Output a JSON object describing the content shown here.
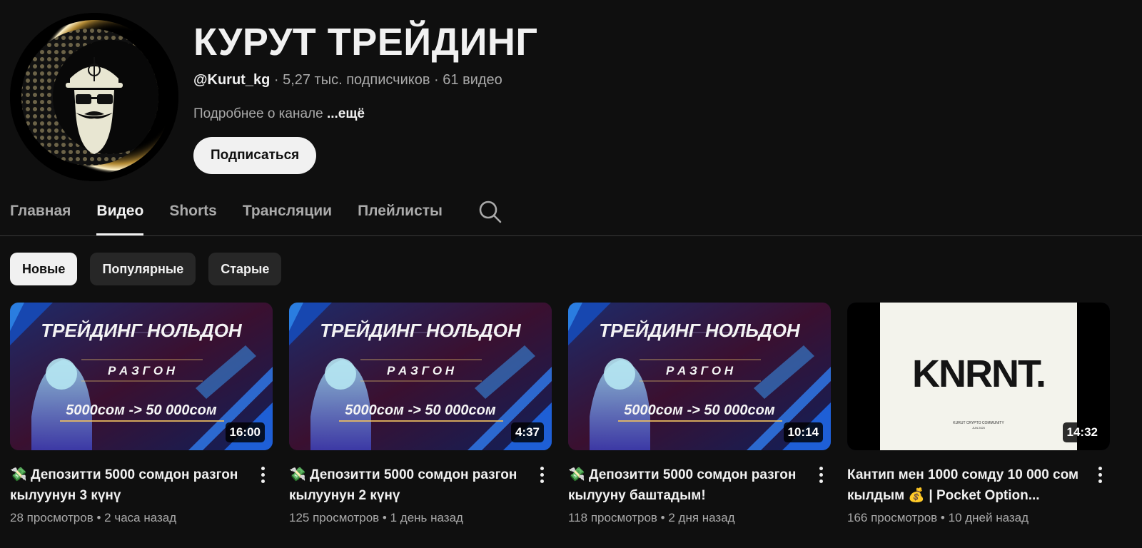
{
  "channel": {
    "title": "КУРУТ ТРЕЙДИНГ",
    "handle": "@Kurut_kg",
    "subscribers": "5,27 тыс. подписчиков",
    "video_count": "61 видео",
    "separator": " · ",
    "about": "Подробнее о канале",
    "more": "...ещё",
    "subscribe_label": "Подписаться"
  },
  "tabs": [
    {
      "label": "Главная",
      "active": false
    },
    {
      "label": "Видео",
      "active": true
    },
    {
      "label": "Shorts",
      "active": false
    },
    {
      "label": "Трансляции",
      "active": false
    },
    {
      "label": "Плейлисты",
      "active": false
    }
  ],
  "chips": [
    {
      "label": "Новые",
      "active": true
    },
    {
      "label": "Популярные",
      "active": false
    },
    {
      "label": "Старые",
      "active": false
    }
  ],
  "thumb_text": {
    "headline": "ТРЕЙДИНГ НОЛЬДОН",
    "sub": "Р А З Г О Н",
    "amount": "5000сом -> 50 000сом",
    "logo": "KNRNT.",
    "logo_caption_1": "KURUT CRYPTO COMMUNITY",
    "logo_caption_2": "JUN 2025"
  },
  "videos": [
    {
      "emoji": "💸",
      "title": "Депозитти 5000 сомдон разгон кылуунун 3 күнү",
      "views": "28 просмотров",
      "age": "2 часа назад",
      "duration": "16:00",
      "thumb": "trading"
    },
    {
      "emoji": "💸",
      "title": "Депозитти 5000 сомдон разгон кылуунун 2 күнү",
      "views": "125 просмотров",
      "age": "1 день назад",
      "duration": "4:37",
      "thumb": "trading"
    },
    {
      "emoji": "💸",
      "title": "Депозитти 5000 сомдон разгон кылууну баштадым!",
      "views": "118 просмотров",
      "age": "2 дня назад",
      "duration": "10:14",
      "thumb": "trading"
    },
    {
      "emoji": "",
      "title": "Кантип мен 1000 сомду 10 000 сом кылдым 💰 | Pocket Option...",
      "views": "166 просмотров",
      "age": "10 дней назад",
      "duration": "14:32",
      "thumb": "logo"
    }
  ],
  "stat_separator": " • ",
  "colors": {
    "background": "#0f0f0f",
    "text": "#f1f1f1",
    "secondary_text": "#aaaaaa",
    "chip": "#272727",
    "thumb_blue": "#1a4fd8"
  },
  "icons": {
    "search": "search-icon",
    "more": "more-vert-icon"
  }
}
